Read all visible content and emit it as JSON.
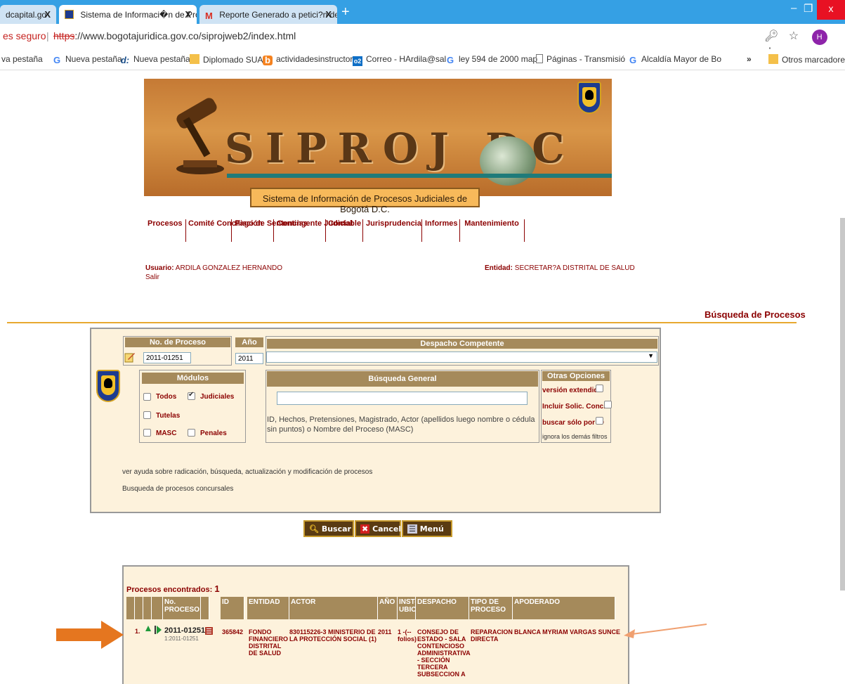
{
  "browser": {
    "tabs": [
      {
        "label": "dcapital.go"
      },
      {
        "label": "Sistema de Informaci�n de Proc"
      },
      {
        "label": "Reporte Generado a petici?n del"
      }
    ],
    "close_glyph": "X",
    "new_tab": "+",
    "window_minimize": "‒",
    "window_restore": "❐",
    "window_close": "x",
    "security": "es seguro",
    "url_scheme": "https",
    "url_rest": "://www.bogotajuridica.gov.co/siprojweb2/index.html",
    "avatar_letter": "H",
    "bookmarks": [
      {
        "label": "va pestaña",
        "icon": ""
      },
      {
        "label": "Nueva pestaña",
        "icon": "google-icon"
      },
      {
        "label": "Nueva pestaña",
        "icon": "dc-icon"
      },
      {
        "label": "Diplomado SUA",
        "icon": "folder-icon"
      },
      {
        "label": "actividadesinstructor",
        "icon": "orange-b-icon"
      },
      {
        "label": "Correo - HArdila@sal",
        "icon": "outlook-icon"
      },
      {
        "label": "ley 594 de 2000 map",
        "icon": "google-icon"
      },
      {
        "label": "Páginas - Transmisió",
        "icon": "page-icon"
      },
      {
        "label": "Alcaldía Mayor de Bo",
        "icon": "google-icon"
      }
    ],
    "bookmarks_more": "»",
    "other_bookmarks": "Otros marcadores"
  },
  "header": {
    "logo_text": "SIPROJ DC",
    "caption": "Sistema de Información de Procesos Judiciales de Bogotá D.C."
  },
  "menu": [
    {
      "label": "Procesos"
    },
    {
      "label": "Comité Conciliación"
    },
    {
      "label": "Pago de Sentencias"
    },
    {
      "label": "Contingente Judicial"
    },
    {
      "label": "Contable"
    },
    {
      "label": "Jurisprudencia"
    },
    {
      "label": "Informes"
    },
    {
      "label": "Mantenimiento"
    }
  ],
  "user": {
    "usuario_label": "Usuario:",
    "usuario_value": "ARDILA GONZALEZ HERNANDO",
    "salir": "Salir",
    "entidad_label": "Entidad:",
    "entidad_value": "SECRETAR?A DISTRITAL DE SALUD"
  },
  "page_title": "Búsqueda de Procesos",
  "search": {
    "no_proceso_header": "No. de Proceso",
    "no_proceso_value": "2011-01251",
    "anio_header": "Año",
    "anio_value": "2011",
    "despacho_header": "Despacho Competente",
    "despacho_value": "",
    "modulos_header": "Módulos",
    "modulos": [
      {
        "label": "Todos",
        "checked": false
      },
      {
        "label": "Judiciales",
        "checked": true
      },
      {
        "label": "Tutelas",
        "checked": false
      },
      {
        "label": "MASC",
        "checked": false
      },
      {
        "label": "Penales",
        "checked": false
      }
    ],
    "general_header": "Búsqueda General",
    "general_value": "",
    "general_help": "ID, Hechos, Pretensiones, Magistrado, Actor (apellidos luego nombre o cédula sin puntos) o Nombre del Proceso (MASC)",
    "otras_header": "Otras Opciones",
    "otras": [
      {
        "label": "versión extendida"
      },
      {
        "label": "Incluir Solic. Conc."
      },
      {
        "label": "buscar sólo por ID"
      },
      {
        "label": "ignora los demás filtros"
      }
    ],
    "help_link": "ver ayuda sobre radicación, búsqueda, actualización y modificación de procesos",
    "concursales_link": "Busqueda de procesos concursales"
  },
  "buttons": {
    "buscar": "Buscar",
    "cancelar": "Cancelar",
    "menu": "Menú"
  },
  "results": {
    "title": "Procesos encontrados:",
    "count": "1",
    "headers": [
      "No. PROCESO",
      "ID",
      "ENTIDAD",
      "ACTOR",
      "AÑO",
      "INST-UBIC",
      "DESPACHO",
      "TIPO DE PROCESO",
      "APODERADO"
    ],
    "row": {
      "index": "1.",
      "proceso": "2011-01251",
      "proceso_sub": "1:2011-01251",
      "id": "365842",
      "entidad": "FONDO FINANCIERO DISTRITAL DE SALUD",
      "actor": "830115226-3 MINISTERIO DE LA PROTECCIÓN SOCIAL (1)",
      "anio": "2011",
      "inst": "1 -(-- folios)",
      "despacho": "CONSEJO DE ESTADO - SALA CONTENCIOSO ADMINISTRATIVA - SECCIÓN TERCERA SUBSECCION A",
      "tipo": "REPARACION DIRECTA",
      "apoderado": "BLANCA MYRIAM VARGAS SUNCE"
    }
  }
}
